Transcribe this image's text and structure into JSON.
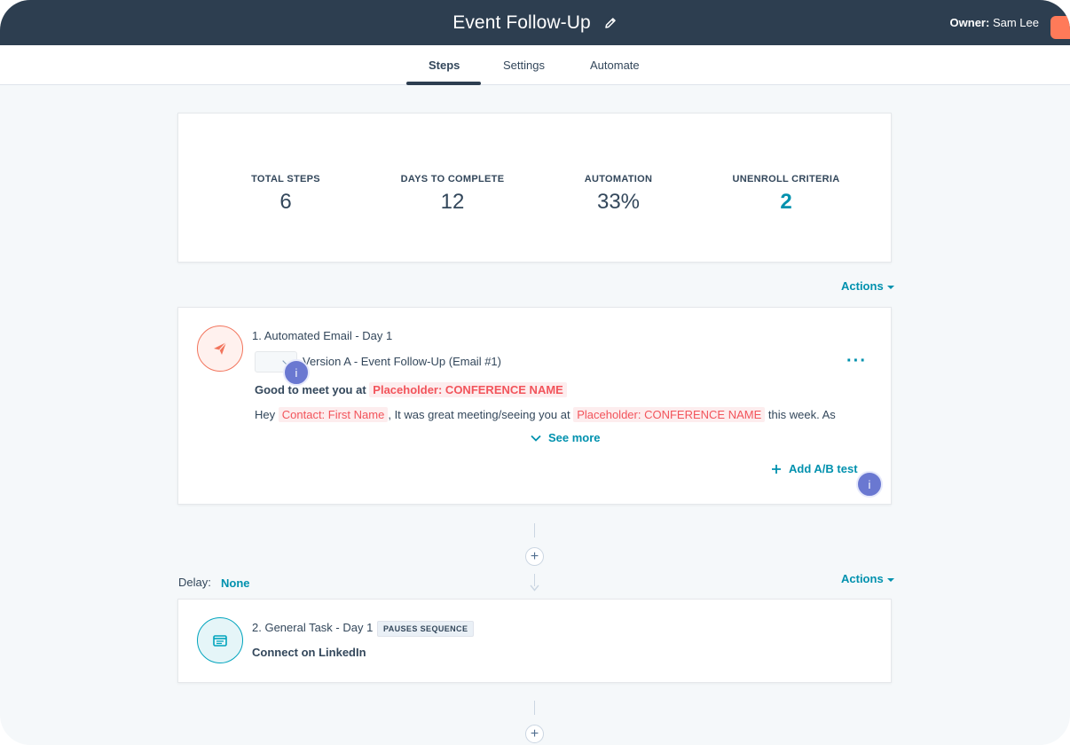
{
  "header": {
    "title": "Event Follow-Up",
    "owner_label": "Owner:",
    "owner_name": "Sam Lee"
  },
  "tabs": [
    {
      "label": "Steps",
      "active": true
    },
    {
      "label": "Settings",
      "active": false
    },
    {
      "label": "Automate",
      "active": false
    }
  ],
  "stats": [
    {
      "label": "TOTAL STEPS",
      "value": "6"
    },
    {
      "label": "DAYS TO COMPLETE",
      "value": "12"
    },
    {
      "label": "AUTOMATION",
      "value": "33%"
    },
    {
      "label": "UNENROLL CRITERIA",
      "value": "2"
    }
  ],
  "actions_label": "Actions",
  "step1": {
    "title": "1. Automated Email - Day 1",
    "version": "Version A - Event Follow-Up (Email #1)",
    "subject_prefix": "Good to meet you at",
    "subject_token": "Placeholder: CONFERENCE NAME",
    "body_prefix": "Hey",
    "body_token1": "Contact: First Name",
    "body_mid": ", It was great meeting/seeing you at",
    "body_token2": "Placeholder: CONFERENCE NAME",
    "body_suffix": "this week. As",
    "see_more": "See more",
    "ab_test": "Add A/B test",
    "info_glyph": "i",
    "kebab": "···"
  },
  "delay": {
    "label": "Delay:",
    "value": "None"
  },
  "step2": {
    "title": "2. General Task - Day 1",
    "badge": "PAUSES SEQUENCE",
    "task_name": "Connect on LinkedIn"
  },
  "plus_glyph": "+",
  "colors": {
    "header_bg": "#2d3e50",
    "accent_teal": "#0091ae",
    "email_icon": "#f2745c",
    "task_icon": "#00a4bd",
    "info_badge": "#6a78d1",
    "token_text": "#f2545b",
    "orange_chip": "#ff7a59"
  }
}
